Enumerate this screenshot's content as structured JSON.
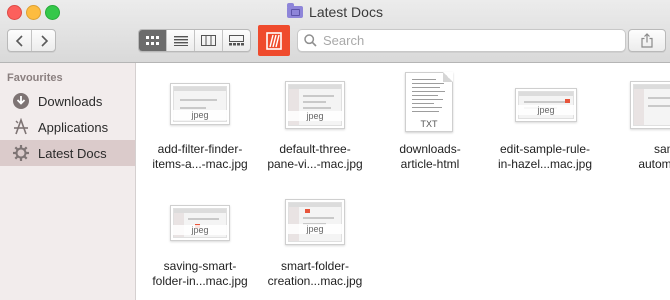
{
  "window": {
    "title": "Latest Docs"
  },
  "toolbar": {
    "back_label": "‹",
    "forward_label": "›",
    "search_placeholder": "Search",
    "view_modes": [
      "icon-view",
      "list-view",
      "column-view",
      "gallery-view"
    ],
    "active_view": "icon-view",
    "hazel_color": "#ef4b2d"
  },
  "sidebar": {
    "heading": "Favourites",
    "items": [
      {
        "label": "Downloads",
        "icon": "download-icon",
        "selected": false
      },
      {
        "label": "Applications",
        "icon": "applications-icon",
        "selected": false
      },
      {
        "label": "Latest Docs",
        "icon": "gear-folder-icon",
        "selected": true
      }
    ]
  },
  "files": [
    {
      "line1": "add-filter-finder-",
      "line2": "items-a...-mac.jpg",
      "ext": "jpeg",
      "kind": "image"
    },
    {
      "line1": "default-three-",
      "line2": "pane-vi...-mac.jpg",
      "ext": "jpeg",
      "kind": "image"
    },
    {
      "line1": "downloads-",
      "line2": "article-html",
      "ext": "TXT",
      "kind": "text"
    },
    {
      "line1": "edit-sample-rule-",
      "line2": "in-hazel...mac.jpg",
      "ext": "jpeg",
      "kind": "image"
    },
    {
      "line1": "sampl",
      "line2": "automat...m",
      "ext": "",
      "kind": "image"
    },
    {
      "line1": "saving-smart-",
      "line2": "folder-in...mac.jpg",
      "ext": "jpeg",
      "kind": "image"
    },
    {
      "line1": "smart-folder-",
      "line2": "creation...mac.jpg",
      "ext": "jpeg",
      "kind": "image"
    }
  ]
}
